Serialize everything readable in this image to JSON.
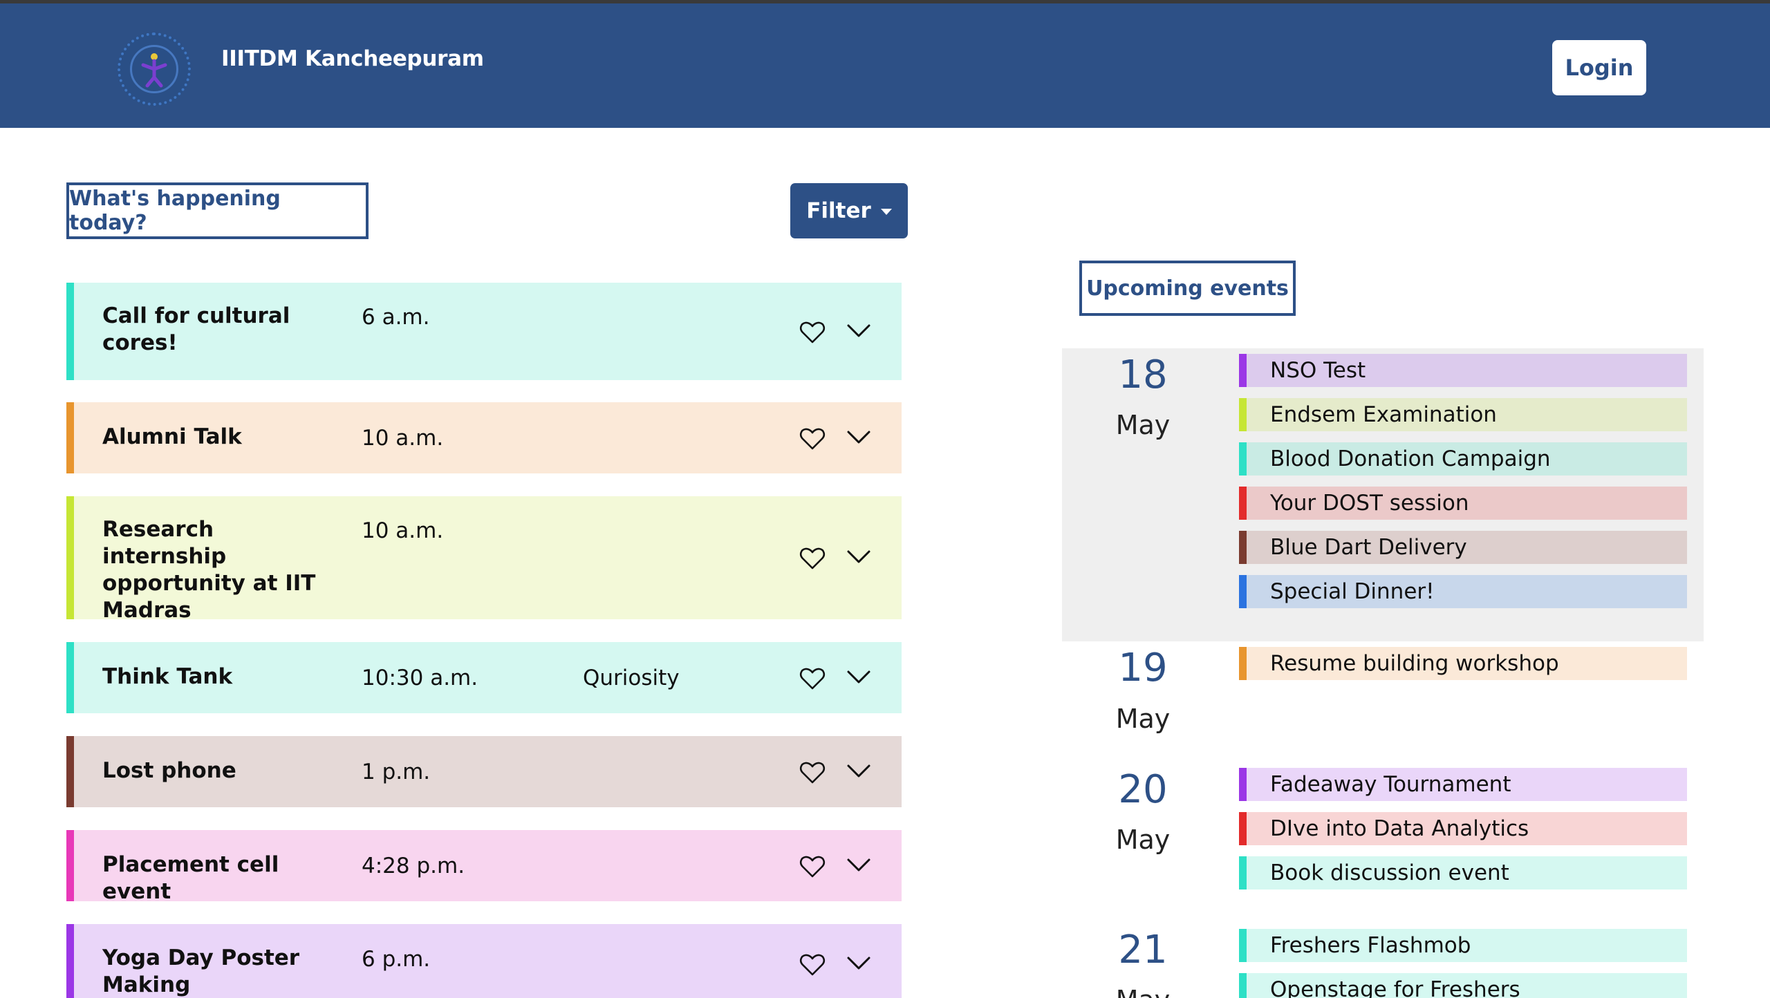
{
  "header": {
    "brand": "IIITDM Kancheepuram",
    "login_label": "Login"
  },
  "today_label": "What's happening today?",
  "filter_label": "Filter",
  "events": [
    {
      "title": "Call for cultural cores!",
      "time": "6 a.m.",
      "org": "",
      "accent": "#2ee0c6",
      "bg": "#d5f8f1"
    },
    {
      "title": "Alumni Talk",
      "time": "10 a.m.",
      "org": "",
      "accent": "#e8952e",
      "bg": "#fbe9d8"
    },
    {
      "title": "Research internship opportunity at IIT Madras",
      "time": "10 a.m.",
      "org": "",
      "accent": "#c6e635",
      "bg": "#f3f9d8"
    },
    {
      "title": "Think Tank",
      "time": "10:30 a.m.",
      "org": "Quriosity",
      "accent": "#2ee0c6",
      "bg": "#d5f8f1"
    },
    {
      "title": "Lost phone",
      "time": "1 p.m.",
      "org": "",
      "accent": "#7a3b30",
      "bg": "#e5d9d7"
    },
    {
      "title": "Placement cell event",
      "time": "4:28 p.m.",
      "org": "",
      "accent": "#e838b8",
      "bg": "#f8d5ef"
    },
    {
      "title": "Yoga Day Poster Making",
      "time": "6 p.m.",
      "org": "",
      "accent": "#9b37e6",
      "bg": "#ead6f9"
    }
  ],
  "upcoming_label": "Upcoming events",
  "upcoming": [
    {
      "day": "18",
      "month": "May",
      "items": [
        {
          "label": "NSO Test",
          "accent": "#9b37e6",
          "bg": "#dccbed"
        },
        {
          "label": "Endsem Examination",
          "accent": "#c6e635",
          "bg": "#e5ebcb"
        },
        {
          "label": "Blood Donation Campaign",
          "accent": "#2ee0c6",
          "bg": "#c9ebe4"
        },
        {
          "label": "Your DOST session",
          "accent": "#e32b2b",
          "bg": "#ebc9c9"
        },
        {
          "label": "Blue Dart Delivery",
          "accent": "#7a3b30",
          "bg": "#ddcfcd"
        },
        {
          "label": "Special Dinner!",
          "accent": "#2b73e0",
          "bg": "#c8d7eb"
        }
      ]
    },
    {
      "day": "19",
      "month": "May",
      "items": [
        {
          "label": "Resume building workshop",
          "accent": "#e8952e",
          "bg": "#fbe9d8"
        }
      ]
    },
    {
      "day": "20",
      "month": "May",
      "items": [
        {
          "label": "Fadeaway Tournament",
          "accent": "#9b37e6",
          "bg": "#ead6f9"
        },
        {
          "label": "DIve into Data Analytics",
          "accent": "#e32b2b",
          "bg": "#f8d5d5"
        },
        {
          "label": "Book discussion event",
          "accent": "#2ee0c6",
          "bg": "#d5f8f1"
        }
      ]
    },
    {
      "day": "21",
      "month": "May",
      "items": [
        {
          "label": "Freshers Flashmob",
          "accent": "#2ee0c6",
          "bg": "#d5f8f1"
        },
        {
          "label": "Openstage for Freshers",
          "accent": "#2ee0c6",
          "bg": "#d5f8f1"
        }
      ]
    }
  ]
}
